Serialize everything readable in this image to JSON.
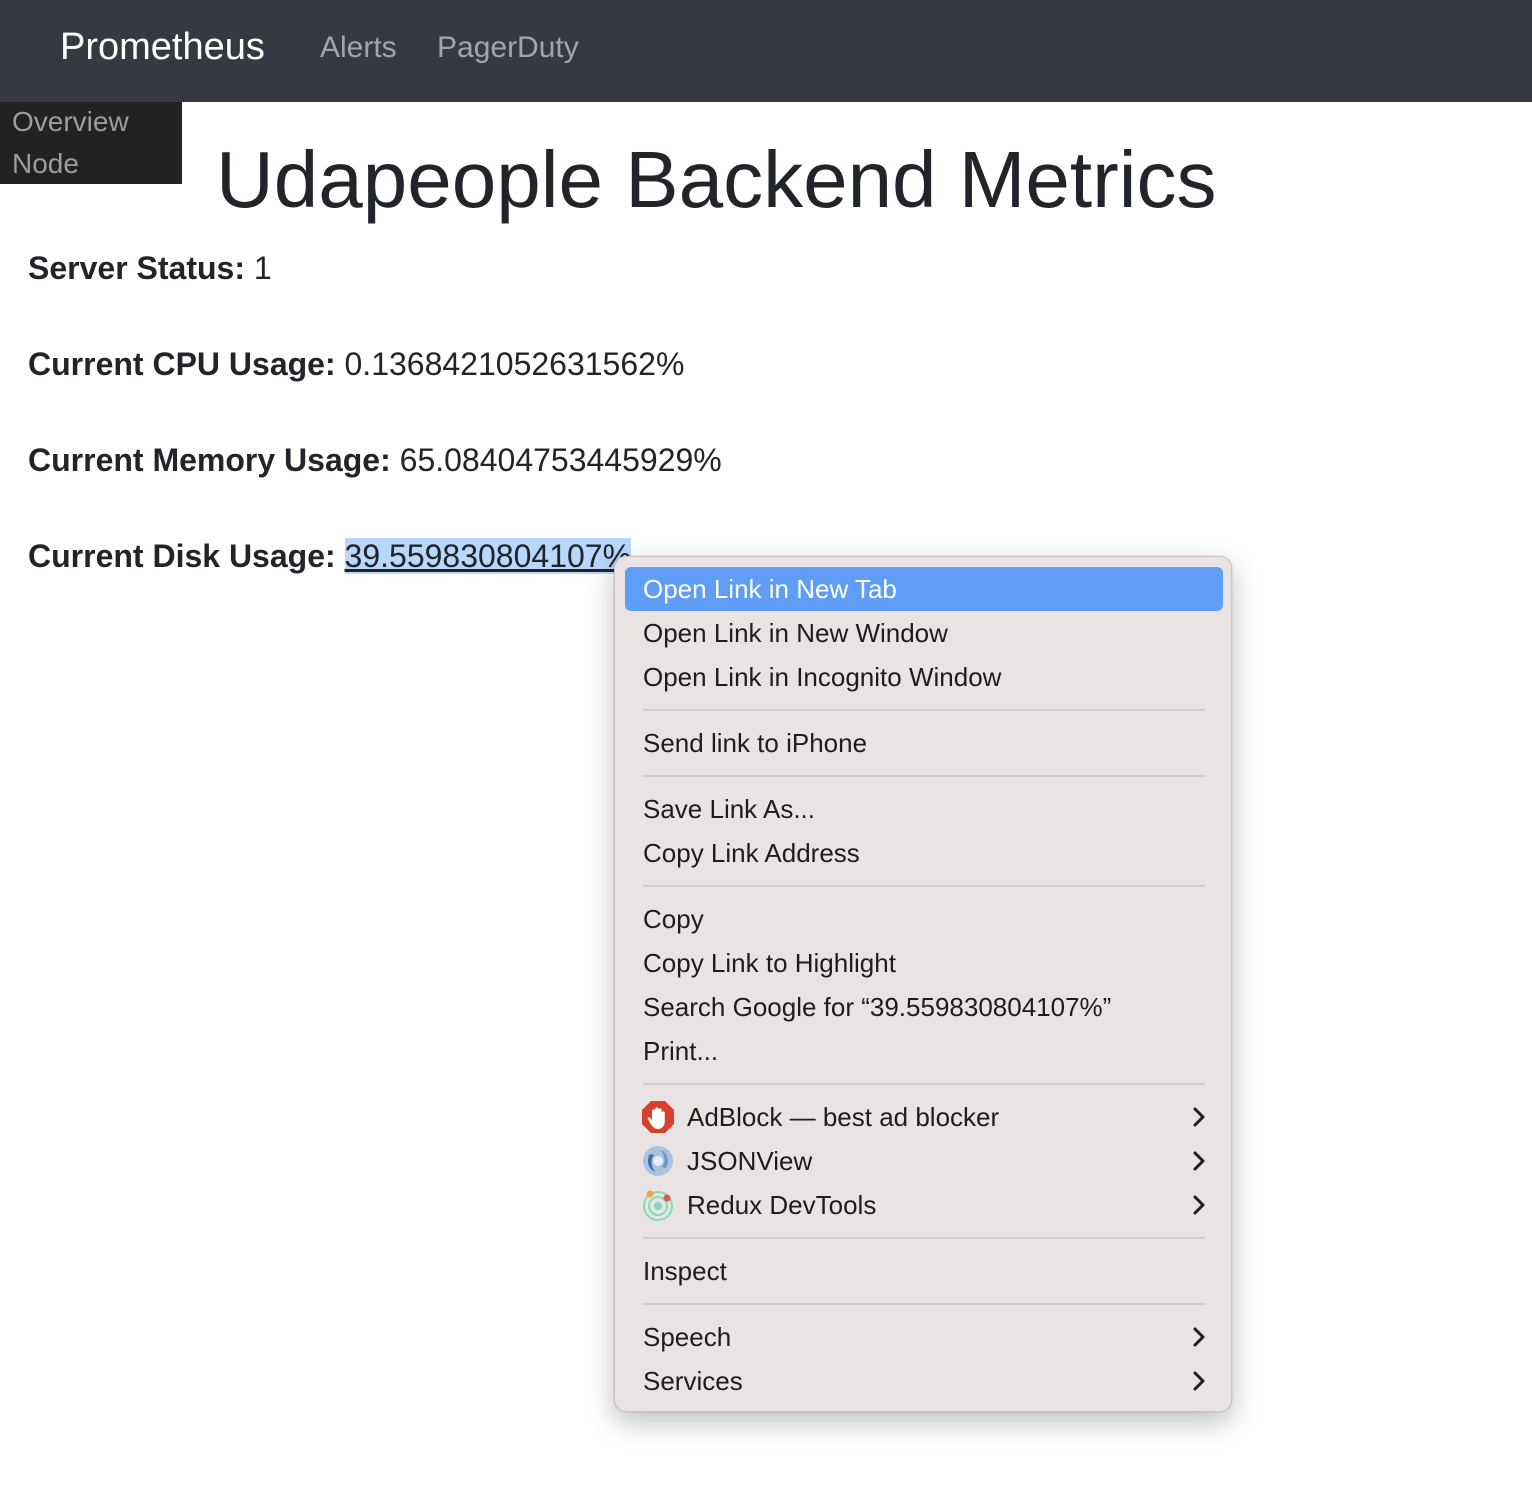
{
  "navbar": {
    "brand": "Prometheus",
    "links": [
      "Alerts",
      "PagerDuty"
    ]
  },
  "sidebar": {
    "items": [
      "Overview",
      "Node"
    ]
  },
  "page": {
    "title": "Udapeople Backend Metrics"
  },
  "metrics": [
    {
      "label": "Server Status:",
      "value": "1"
    },
    {
      "label": "Current CPU Usage:",
      "value": "0.1368421052631562%"
    },
    {
      "label": "Current Memory Usage:",
      "value": "65.08404753445929%"
    },
    {
      "label": "Current Disk Usage:",
      "value": "39.559830804107%"
    }
  ],
  "context_menu": {
    "items": [
      "Open Link in New Tab",
      "Open Link in New Window",
      "Open Link in Incognito Window",
      "Send link to iPhone",
      "Save Link As...",
      "Copy Link Address",
      "Copy",
      "Copy Link to Highlight",
      "Search Google for “39.559830804107%”",
      "Print...",
      "AdBlock — best ad blocker",
      "JSONView",
      "Redux DevTools",
      "Inspect",
      "Speech",
      "Services"
    ],
    "highlighted_item": "Open Link in New Tab",
    "icons": {
      "adblock": "adblock-hand-icon",
      "jsonview": "jsonview-icon",
      "redux": "redux-devtools-icon",
      "submenu": "chevron-right-icon"
    }
  },
  "colors": {
    "navbar_bg": "#343a40",
    "sidebar_bg": "#222222",
    "selection": "#b9d7fb",
    "menu_bg": "#e9e4e3",
    "menu_highlight": "#5f9df7",
    "adblock_red": "#d6402c"
  }
}
